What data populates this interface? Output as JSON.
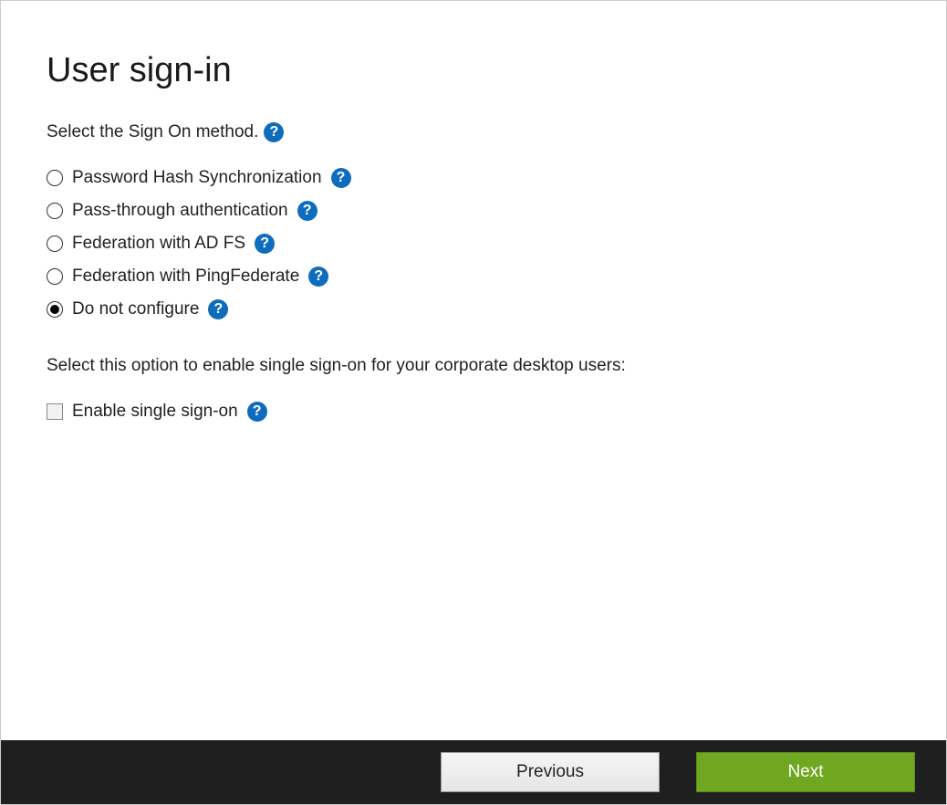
{
  "page": {
    "title": "User sign-in",
    "section_label": "Select the Sign On method.",
    "sso_section_label": "Select this option to enable single sign-on for your corporate desktop users:"
  },
  "options": {
    "password_hash": "Password Hash Synchronization",
    "passthrough": "Pass-through authentication",
    "adfs": "Federation with AD FS",
    "pingfederate": "Federation with PingFederate",
    "do_not_configure": "Do not configure"
  },
  "checkbox": {
    "enable_sso": "Enable single sign-on"
  },
  "buttons": {
    "previous": "Previous",
    "next": "Next"
  },
  "help_glyph": "?"
}
